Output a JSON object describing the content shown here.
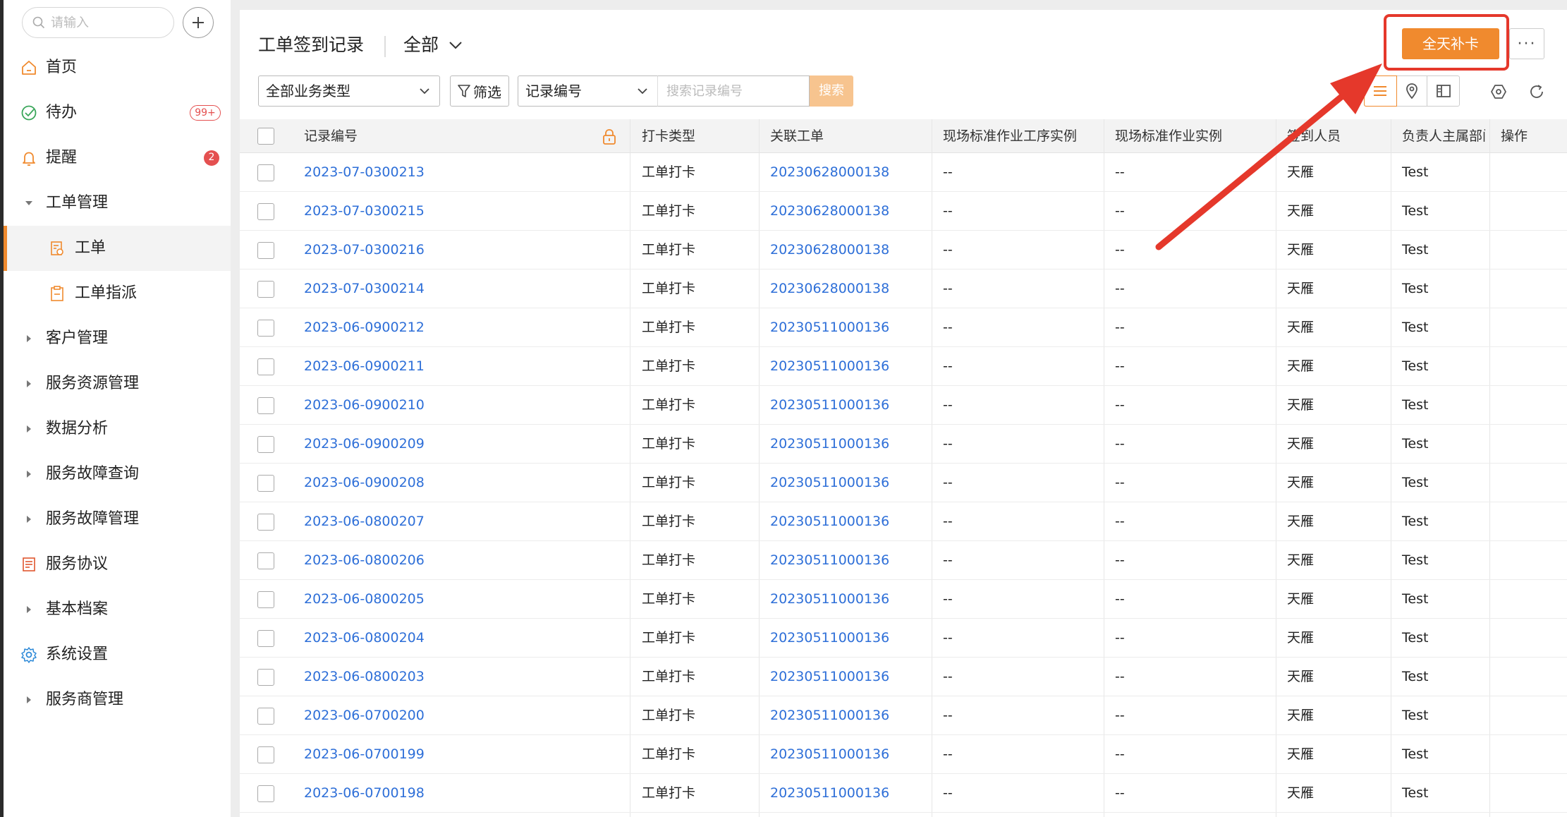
{
  "sidebar": {
    "search_placeholder": "请输入",
    "items": [
      {
        "label": "首页",
        "icon": "home-icon"
      },
      {
        "label": "待办",
        "icon": "check-circle-icon",
        "badge": "99+"
      },
      {
        "label": "提醒",
        "icon": "bell-icon",
        "badge": "2"
      },
      {
        "label": "工单管理",
        "icon": "caret-down-icon"
      },
      {
        "label": "工单",
        "icon": "work-order-icon"
      },
      {
        "label": "工单指派",
        "icon": "clipboard-icon"
      },
      {
        "label": "客户管理",
        "icon": "caret-right-icon"
      },
      {
        "label": "服务资源管理",
        "icon": "caret-right-icon"
      },
      {
        "label": "数据分析",
        "icon": "caret-right-icon"
      },
      {
        "label": "服务故障查询",
        "icon": "caret-right-icon"
      },
      {
        "label": "服务故障管理",
        "icon": "caret-right-icon"
      },
      {
        "label": "服务协议",
        "icon": "document-list-icon"
      },
      {
        "label": "基本档案",
        "icon": "caret-right-icon"
      },
      {
        "label": "系统设置",
        "icon": "gear-icon"
      },
      {
        "label": "服务商管理",
        "icon": "caret-right-icon"
      }
    ]
  },
  "header": {
    "title": "工单签到记录",
    "view": "全部",
    "primary_button": "全天补卡",
    "more": "···"
  },
  "filters": {
    "type_select": "全部业务类型",
    "filter_button": "筛选",
    "field_select": "记录编号",
    "search_placeholder": "搜索记录编号",
    "search_button": "搜索"
  },
  "table": {
    "columns": [
      "记录编号",
      "打卡类型",
      "关联工单",
      "现场标准作业工序实例",
      "现场标准作业实例",
      "签到人员",
      "负责人主属部门",
      "操作"
    ],
    "rows": [
      [
        "2023-07-0300213",
        "工单打卡",
        "20230628000138",
        "--",
        "--",
        "天雁",
        "Test"
      ],
      [
        "2023-07-0300215",
        "工单打卡",
        "20230628000138",
        "--",
        "--",
        "天雁",
        "Test"
      ],
      [
        "2023-07-0300216",
        "工单打卡",
        "20230628000138",
        "--",
        "--",
        "天雁",
        "Test"
      ],
      [
        "2023-07-0300214",
        "工单打卡",
        "20230628000138",
        "--",
        "--",
        "天雁",
        "Test"
      ],
      [
        "2023-06-0900212",
        "工单打卡",
        "20230511000136",
        "--",
        "--",
        "天雁",
        "Test"
      ],
      [
        "2023-06-0900211",
        "工单打卡",
        "20230511000136",
        "--",
        "--",
        "天雁",
        "Test"
      ],
      [
        "2023-06-0900210",
        "工单打卡",
        "20230511000136",
        "--",
        "--",
        "天雁",
        "Test"
      ],
      [
        "2023-06-0900209",
        "工单打卡",
        "20230511000136",
        "--",
        "--",
        "天雁",
        "Test"
      ],
      [
        "2023-06-0900208",
        "工单打卡",
        "20230511000136",
        "--",
        "--",
        "天雁",
        "Test"
      ],
      [
        "2023-06-0800207",
        "工单打卡",
        "20230511000136",
        "--",
        "--",
        "天雁",
        "Test"
      ],
      [
        "2023-06-0800206",
        "工单打卡",
        "20230511000136",
        "--",
        "--",
        "天雁",
        "Test"
      ],
      [
        "2023-06-0800205",
        "工单打卡",
        "20230511000136",
        "--",
        "--",
        "天雁",
        "Test"
      ],
      [
        "2023-06-0800204",
        "工单打卡",
        "20230511000136",
        "--",
        "--",
        "天雁",
        "Test"
      ],
      [
        "2023-06-0800203",
        "工单打卡",
        "20230511000136",
        "--",
        "--",
        "天雁",
        "Test"
      ],
      [
        "2023-06-0700200",
        "工单打卡",
        "20230511000136",
        "--",
        "--",
        "天雁",
        "Test"
      ],
      [
        "2023-06-0700199",
        "工单打卡",
        "20230511000136",
        "--",
        "--",
        "天雁",
        "Test"
      ],
      [
        "2023-06-0700198",
        "工单打卡",
        "20230511000136",
        "--",
        "--",
        "天雁",
        "Test"
      ]
    ]
  },
  "colors": {
    "accent": "#f08a2e",
    "link": "#2e6fd8",
    "badge": "#e45050",
    "annotation": "#e5382b"
  }
}
